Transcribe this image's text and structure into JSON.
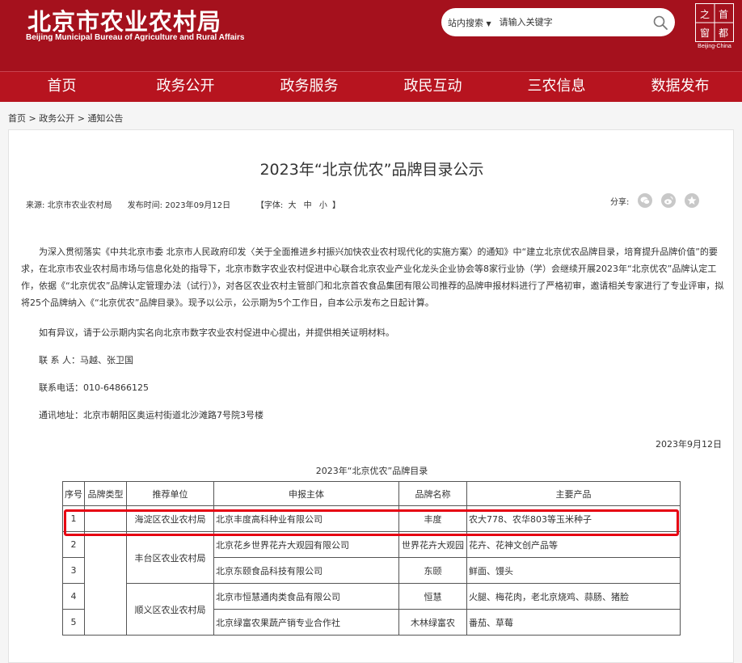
{
  "header": {
    "logo_cn": "北京市农业农村局",
    "logo_en": "Beijing Municipal Bureau of Agriculture and Rural Affairs",
    "search_scope": "站内搜索",
    "search_placeholder": "请输入关键字",
    "emblem_chars": [
      "之",
      "首",
      "都",
      "窗"
    ],
    "emblem_en": "Beijing-China"
  },
  "nav": [
    "首页",
    "政务公开",
    "政务服务",
    "政民互动",
    "三农信息",
    "数据发布"
  ],
  "breadcrumb": [
    "首页",
    "政务公开",
    "通知公告"
  ],
  "breadcrumb_sep": ">",
  "article": {
    "title": "2023年“北京优农”品牌目录公示",
    "source_label": "来源:",
    "source": "北京市农业农村局",
    "time_label": "发布时间:",
    "time": "2023年09月12日",
    "font_label": "【字体:",
    "font_sizes": [
      "大",
      "中",
      "小"
    ],
    "font_end": "】",
    "share_label": "分享:",
    "paragraphs": [
      "为深入贯彻落实《中共北京市委 北京市人民政府印发〈关于全面推进乡村振兴加快农业农村现代化的实施方案〉的通知》中“建立北京优农品牌目录，培育提升品牌价值”的要求，在北京市农业农村局市场与信息化处的指导下，北京市数字农业农村促进中心联合北京农业产业化龙头企业协会等8家行业协（学）会继续开展2023年“北京优农”品牌认定工作，依据《“北京优农”品牌认定管理办法（试行）》，对各区农业农村主管部门和北京首农食品集团有限公司推荐的品牌申报材料进行了严格初审，邀请相关专家进行了专业评审，拟将25个品牌纳入《“北京优农”品牌目录》。现予以公示，公示期为5个工作日，自本公示发布之日起计算。",
      "如有异议，请于公示期内实名向北京市数字农业农村促进中心提出，并提供相关证明材料。"
    ],
    "contact_person": "联 系 人：马越、张卫国",
    "contact_phone": "联系电话：010-64866125",
    "contact_address": "通讯地址：北京市朝阳区奥运村街道北沙滩路7号院3号楼",
    "date": "2023年9月12日"
  },
  "table": {
    "caption": "2023年“北京优农”品牌目录",
    "headers": [
      "序号",
      "品牌类型",
      "推荐单位",
      "申报主体",
      "品牌名称",
      "主要产品"
    ],
    "rows": [
      {
        "no": "1",
        "unit": "海淀区农业农村局",
        "entity": "北京丰度高科种业有限公司",
        "brand": "丰度",
        "product": "农大778、农华803等玉米种子"
      },
      {
        "no": "2",
        "entity": "北京花乡世界花卉大观园有限公司",
        "brand": "世界花卉大观园",
        "product": "花卉、花神文创产品等"
      },
      {
        "no": "3",
        "entity": "北京东颐食品科技有限公司",
        "brand": "东颐",
        "product": "鲜面、馒头"
      },
      {
        "no": "4",
        "entity": "北京市恒慧通肉类食品有限公司",
        "brand": "恒慧",
        "product": "火腿、梅花肉，老北京烧鸡、蒜肠、猪脸"
      },
      {
        "no": "5",
        "entity": "北京绿富农果蔬产销专业合作社",
        "brand": "木林绿富农",
        "product": "番茄、草莓"
      }
    ],
    "merged_units": [
      "丰台区农业农村局",
      "顺义区农业农村局"
    ]
  }
}
